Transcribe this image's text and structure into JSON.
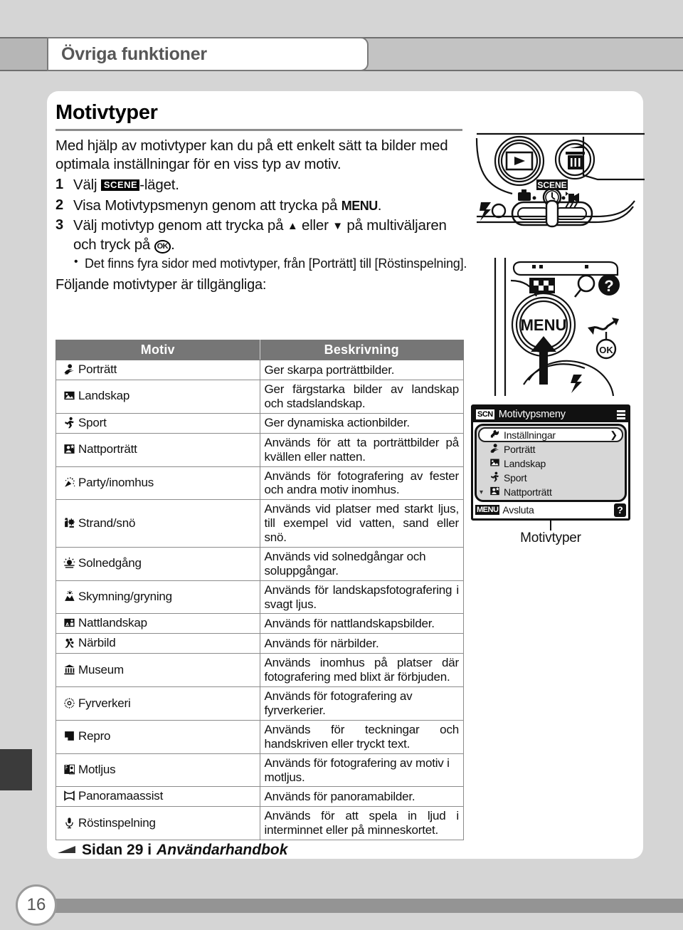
{
  "header": {
    "tab_title": "Övriga funktioner"
  },
  "section": {
    "title": "Motivtyper",
    "intro": "Med hjälp av motivtyper kan du på ett enkelt sätt ta bilder med optimala inställningar för en viss typ av motiv.",
    "steps": [
      {
        "num": "1",
        "before": "Välj ",
        "badge": "SCENE",
        "after": "-läget."
      },
      {
        "num": "2",
        "before": "Visa Motivtypsmenyn genom att trycka på ",
        "badge": "MENU",
        "after": "."
      },
      {
        "num": "3",
        "before": "Välj motivtyp genom att trycka på ",
        "badge": "▲",
        "mid": " eller ",
        "badge2": "▼",
        "after": " på multiväljaren och tryck på ",
        "badge3": "OK",
        "end": "."
      }
    ],
    "bullet": "Det finns fyra sidor med motivtyper, från [Porträtt] till [Röstinspelning].",
    "avail": "Följande motivtyper är tillgängliga:"
  },
  "table": {
    "headers": [
      "Motiv",
      "Beskrivning"
    ],
    "rows": [
      {
        "icon": "portrait-icon",
        "motiv": "Porträtt",
        "desc": "Ger skarpa porträttbilder.",
        "justify": false
      },
      {
        "icon": "landscape-icon",
        "motiv": "Landskap",
        "desc": "Ger färgstarka bilder av landskap och stadslandskap.",
        "justify": true
      },
      {
        "icon": "sport-icon",
        "motiv": "Sport",
        "desc": "Ger dynamiska actionbilder.",
        "justify": false
      },
      {
        "icon": "night-portrait-icon",
        "motiv": "Nattporträtt",
        "desc": "Används för att ta porträttbilder på kvällen eller natten.",
        "justify": true
      },
      {
        "icon": "party-icon",
        "motiv": "Party/inomhus",
        "desc": "Används för fotografering av fester och andra motiv inomhus.",
        "justify": true
      },
      {
        "icon": "beach-snow-icon",
        "motiv": "Strand/snö",
        "desc": "Används vid platser med starkt ljus, till exempel vid vatten, sand eller snö.",
        "justify": true
      },
      {
        "icon": "sunset-icon",
        "motiv": "Solnedgång",
        "desc": "Används vid solnedgångar och soluppgångar.",
        "justify": false
      },
      {
        "icon": "dusk-dawn-icon",
        "motiv": "Skymning/gryning",
        "desc": "Används för landskapsfotografering i svagt ljus.",
        "justify": true
      },
      {
        "icon": "night-landscape-icon",
        "motiv": "Nattlandskap",
        "desc": "Används för nattlandskapsbilder.",
        "justify": false
      },
      {
        "icon": "closeup-icon",
        "motiv": "Närbild",
        "desc": "Används för närbilder.",
        "justify": false
      },
      {
        "icon": "museum-icon",
        "motiv": "Museum",
        "desc": "Används inomhus på platser där fotografering med blixt är förbjuden.",
        "justify": true
      },
      {
        "icon": "fireworks-icon",
        "motiv": "Fyrverkeri",
        "desc": "Används för fotografering av fyrverkerier.",
        "justify": false
      },
      {
        "icon": "copy-icon",
        "motiv": "Repro",
        "desc": "Används för teckningar och handskriven eller tryckt text.",
        "justify": true
      },
      {
        "icon": "backlight-icon",
        "motiv": "Motljus",
        "desc": "Används för fotografering av motiv i motljus.",
        "justify": false
      },
      {
        "icon": "panorama-icon",
        "motiv": "Panoramaassist",
        "desc": "Används för panoramabilder.",
        "justify": false
      },
      {
        "icon": "voice-recording-icon",
        "motiv": "Röstinspelning",
        "desc": "Används för att spela in ljud i interminnet eller på minneskortet.",
        "justify": true
      }
    ]
  },
  "reference": {
    "prefix": "Sidan 29 i ",
    "italic": "Användarhandbok"
  },
  "page_number": "16",
  "illustration": {
    "caption": "Motivtyper",
    "camera_top": {
      "playback_label": "playback-button",
      "delete_label": "delete-button",
      "scene_label": "SCENE",
      "flash_label": "flash-indicator"
    },
    "camera_back": {
      "menu_label": "MENU",
      "ok_label": "OK",
      "help_label": "?"
    },
    "lcd": {
      "mode_badge": "SCN",
      "title": "Motivtypsmeny",
      "items": [
        {
          "label": "Inställningar",
          "icon": "settings-icon",
          "selected": true
        },
        {
          "label": "Porträtt",
          "icon": "portrait-icon",
          "selected": false
        },
        {
          "label": "Landskap",
          "icon": "landscape-icon",
          "selected": false
        },
        {
          "label": "Sport",
          "icon": "sport-icon",
          "selected": false
        },
        {
          "label": "Nattporträtt",
          "icon": "night-portrait-icon",
          "selected": false
        }
      ],
      "menu_badge": "MENU",
      "exit_label": "Avsluta",
      "help_badge": "?"
    }
  },
  "colors": {
    "page_bg": "#d5d5d5",
    "header_band": "#c3c3c3",
    "table_header": "#767676",
    "panel": "#ffffff",
    "bottom_bar": "#949494"
  }
}
